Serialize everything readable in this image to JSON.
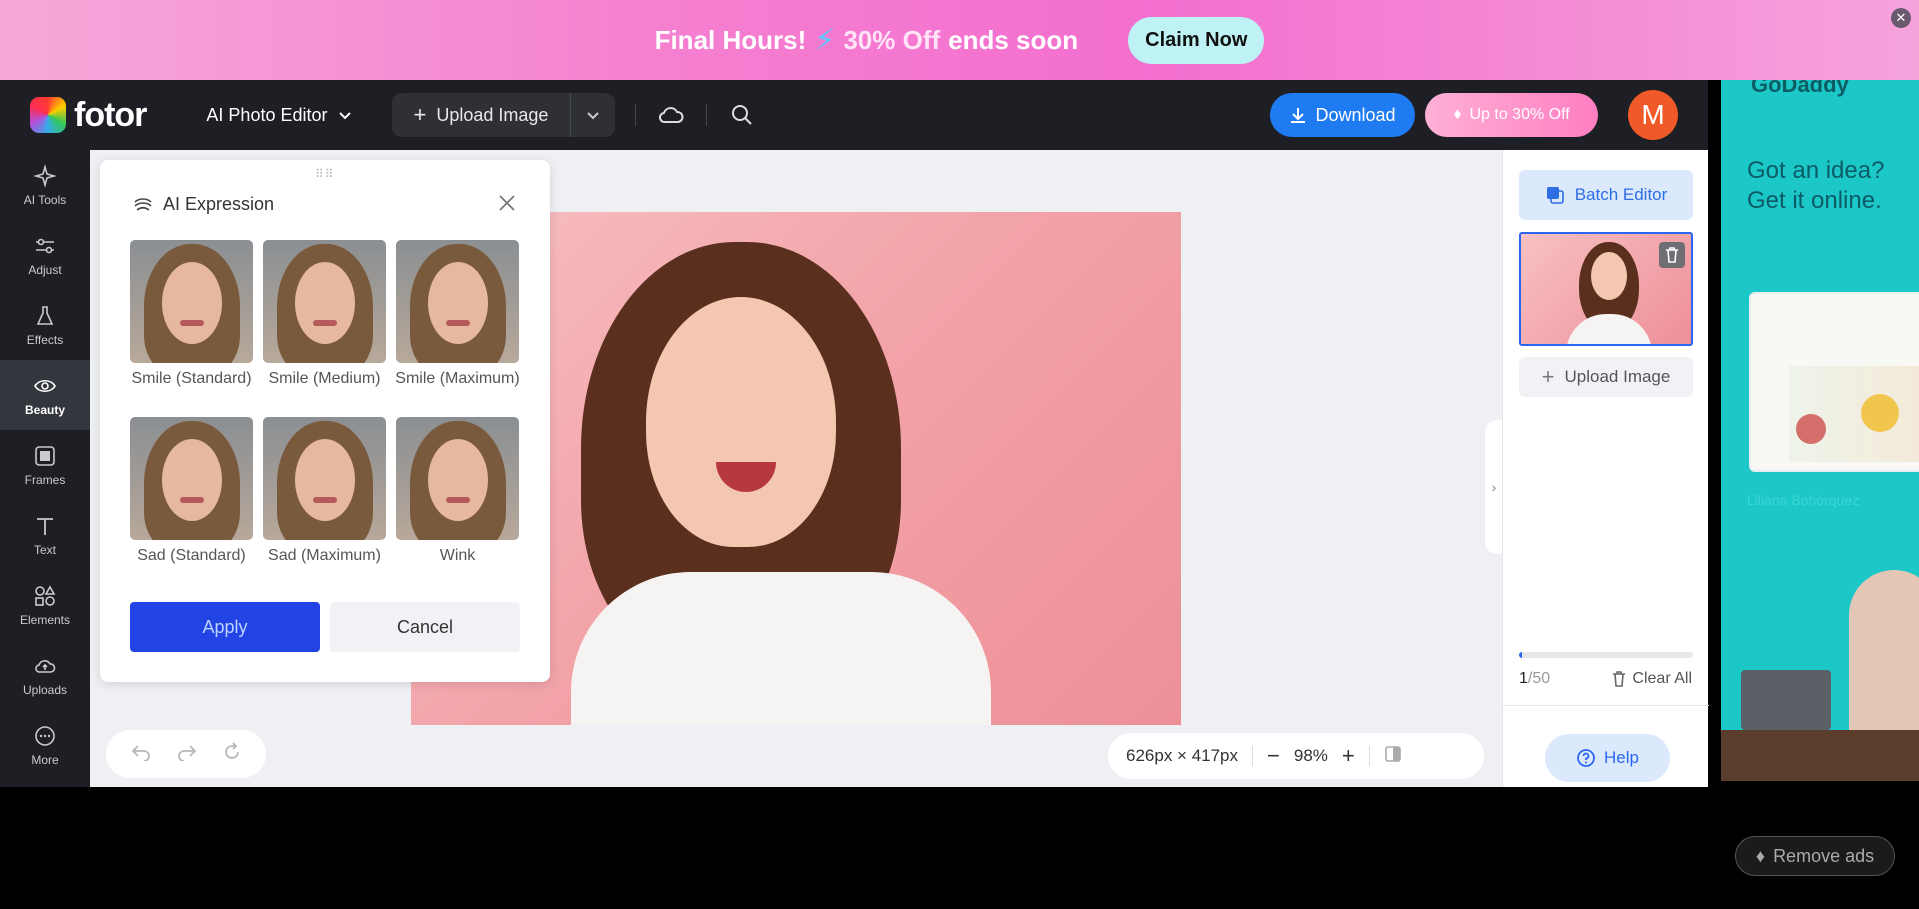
{
  "promo": {
    "text_prefix": "Final Hours!",
    "text_off": "30% Off",
    "text_suffix": "ends soon",
    "claim_label": "Claim Now",
    "close_glyph": "✕"
  },
  "header": {
    "logo_text": "fotor",
    "editor_label": "AI Photo Editor",
    "upload_label": "Upload Image",
    "download_label": "Download",
    "promo_label": "Up to 30% Off",
    "avatar_letter": "M"
  },
  "toolbar": {
    "items": [
      {
        "label": "AI Tools",
        "icon": "sparkle-icon"
      },
      {
        "label": "Adjust",
        "icon": "sliders-icon"
      },
      {
        "label": "Effects",
        "icon": "flask-icon"
      },
      {
        "label": "Beauty",
        "icon": "eye-icon"
      },
      {
        "label": "Frames",
        "icon": "frame-icon"
      },
      {
        "label": "Text",
        "icon": "text-icon"
      },
      {
        "label": "Elements",
        "icon": "shapes-icon"
      },
      {
        "label": "Uploads",
        "icon": "cloud-upload-icon"
      },
      {
        "label": "More",
        "icon": "more-icon"
      }
    ],
    "active": "Beauty"
  },
  "expression_panel": {
    "title": "AI Expression",
    "options": [
      {
        "label": "Smile (Standard)"
      },
      {
        "label": "Smile (Medium)"
      },
      {
        "label": "Smile (Maximum)"
      },
      {
        "label": "Sad (Standard)"
      },
      {
        "label": "Sad (Maximum)"
      },
      {
        "label": "Wink"
      }
    ],
    "apply_label": "Apply",
    "cancel_label": "Cancel"
  },
  "canvas": {
    "dimensions": "626px × 417px",
    "zoom": "98%"
  },
  "right_panel": {
    "batch_label": "Batch Editor",
    "upload_label": "Upload Image",
    "count_current": "1",
    "count_total": "/50",
    "progress_fraction": 0.02,
    "clear_label": "Clear All",
    "help_label": "Help"
  },
  "ad": {
    "brand": "GoDaddy",
    "headline": "Got an idea? Get it online.",
    "caption": "Liliana Bohórquez",
    "remove_label": "Remove ads"
  },
  "colors": {
    "accent": "#1e7bf2",
    "apply": "#2244e5",
    "avatar": "#f05a28"
  }
}
